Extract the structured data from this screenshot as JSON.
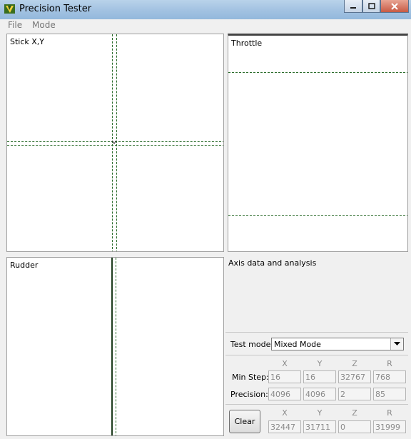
{
  "window": {
    "title": "Precision Tester"
  },
  "menu": [
    "File",
    "Mode"
  ],
  "panels": {
    "stick": {
      "title": "Stick X,Y"
    },
    "throttle": {
      "title": "Throttle"
    },
    "rudder": {
      "title": "Rudder"
    }
  },
  "analysis": {
    "title": "Axis data and analysis"
  },
  "test_mode": {
    "label": "Test mode:",
    "value": "Mixed Mode"
  },
  "columns": [
    "X",
    "Y",
    "Z",
    "R"
  ],
  "rows": {
    "min_step": {
      "label": "Min Step:",
      "values": [
        "16",
        "16",
        "32767",
        "768"
      ]
    },
    "precision": {
      "label": "Precision:",
      "values": [
        "4096",
        "4096",
        "2",
        "85"
      ]
    }
  },
  "clear_button": {
    "label": "Clear"
  },
  "current": {
    "values": [
      "32447",
      "31711",
      "0",
      "31999"
    ]
  }
}
